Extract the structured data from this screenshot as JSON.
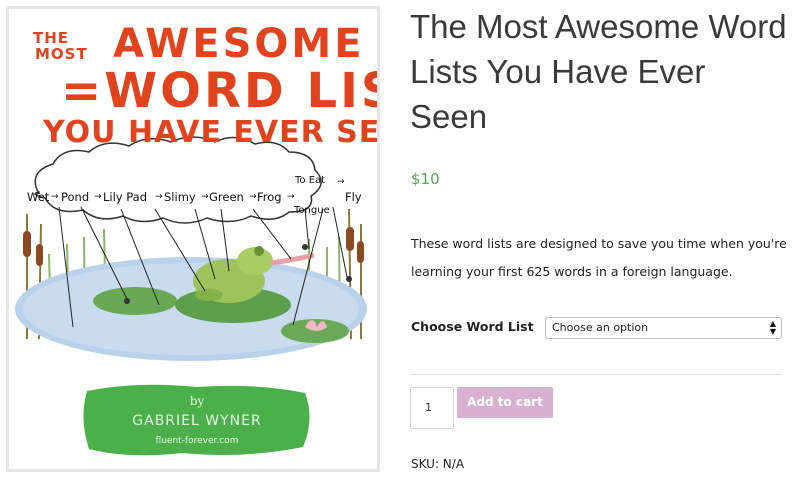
{
  "cover": {
    "title_the": "THE",
    "title_most": "MOST",
    "title_awesome": "AWESOME",
    "title_word_list": "=WORD LIST=",
    "title_line3": "YOU HAVE EVER SEEN",
    "chain": [
      "Wet",
      "Pond",
      "Lily Pad",
      "Slimy",
      "Green",
      "Frog",
      "Tongue",
      "To Eat",
      "Fly"
    ],
    "arrow": "→",
    "by": "by",
    "author": "GABRIEL WYNER",
    "site": "fluent-forever.com"
  },
  "product": {
    "title": "The Most Awesome Word Lists You Have Ever Seen",
    "price": "$10",
    "description": "These word lists are designed to save you time when you're learning your first 625 words in a foreign language.",
    "variation_label": "Choose Word List",
    "variation_selected": "Choose an option",
    "quantity": "1",
    "add_to_cart": "Add to cart",
    "sku_line": "SKU: N/A"
  },
  "colors": {
    "price": "#53a857",
    "button": "#d7b1cf",
    "title_red": "#e0431e",
    "author_green": "#4bb04a"
  }
}
